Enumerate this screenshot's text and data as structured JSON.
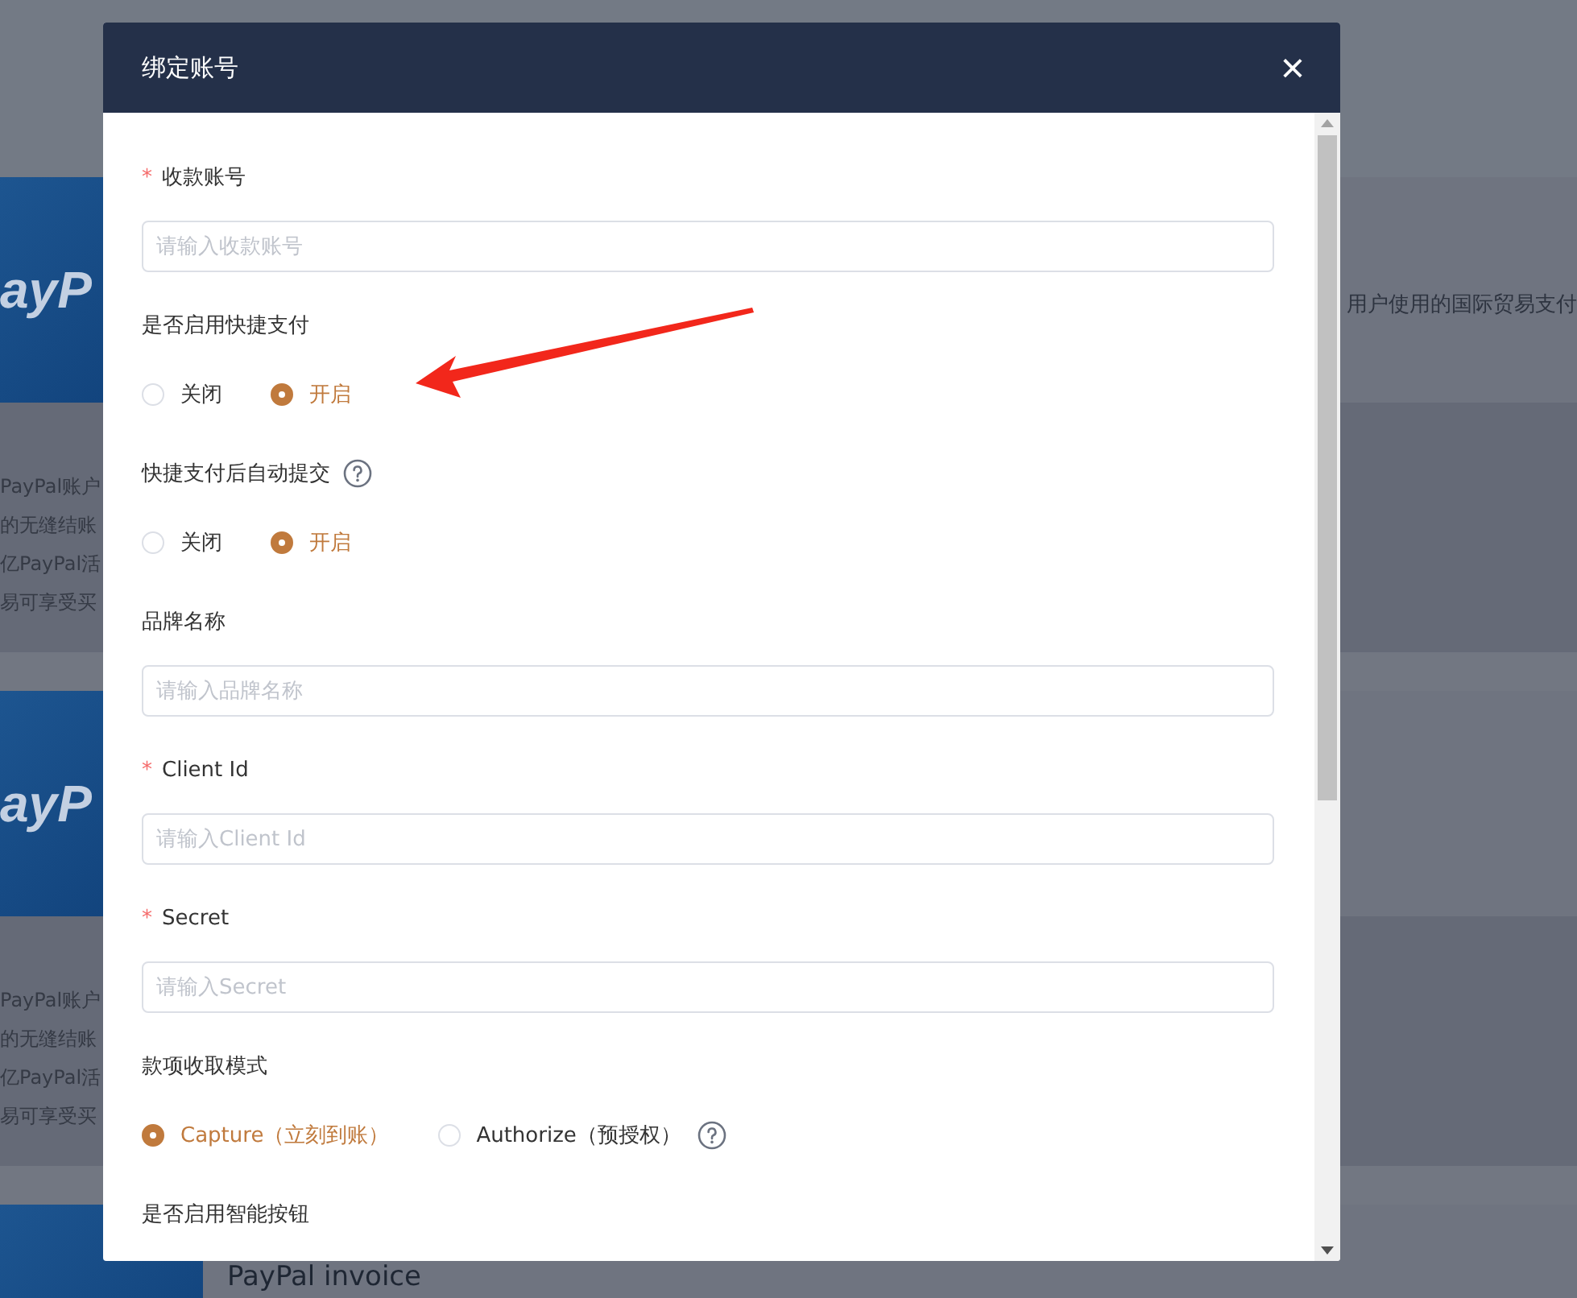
{
  "background": {
    "cards": [
      {
        "logo": "ayP",
        "tagline": "用户使用的国际贸易支付",
        "description": [
          "PayPal账户",
          "的无缝结账",
          "亿PayPal活",
          "易可享受买"
        ]
      },
      {
        "logo": "ayP",
        "description": [
          "PayPal账户",
          "的无缝结账",
          "亿PayPal活",
          "易可享受买"
        ]
      },
      {
        "title": "PayPal invoice"
      }
    ]
  },
  "dialog": {
    "title": "绑定账号",
    "close": "×",
    "fields": [
      {
        "kind": "input",
        "required_mark": "*",
        "label": "收款账号",
        "placeholder": "请输入收款账号"
      },
      {
        "kind": "radio",
        "label": "是否启用快捷支付",
        "options": [
          {
            "label": "关闭",
            "selected": false
          },
          {
            "label": "开启",
            "selected": true
          }
        ]
      },
      {
        "kind": "radio",
        "label": "快捷支付后自动提交",
        "help": true,
        "options": [
          {
            "label": "关闭",
            "selected": false
          },
          {
            "label": "开启",
            "selected": true
          }
        ]
      },
      {
        "kind": "input",
        "label": "品牌名称",
        "placeholder": "请输入品牌名称"
      },
      {
        "kind": "input",
        "required_mark": "*",
        "label": "Client Id",
        "placeholder": "请输入Client Id"
      },
      {
        "kind": "input",
        "required_mark": "*",
        "label": "Secret",
        "placeholder": "请输入Secret"
      },
      {
        "kind": "radio",
        "label": "款项收取模式",
        "options": [
          {
            "label": "Capture（立刻到账）",
            "selected": true
          },
          {
            "label": "Authorize（预授权）",
            "selected": false,
            "help": true
          }
        ]
      },
      {
        "kind": "radio",
        "label": "是否启用智能按钮"
      }
    ]
  }
}
